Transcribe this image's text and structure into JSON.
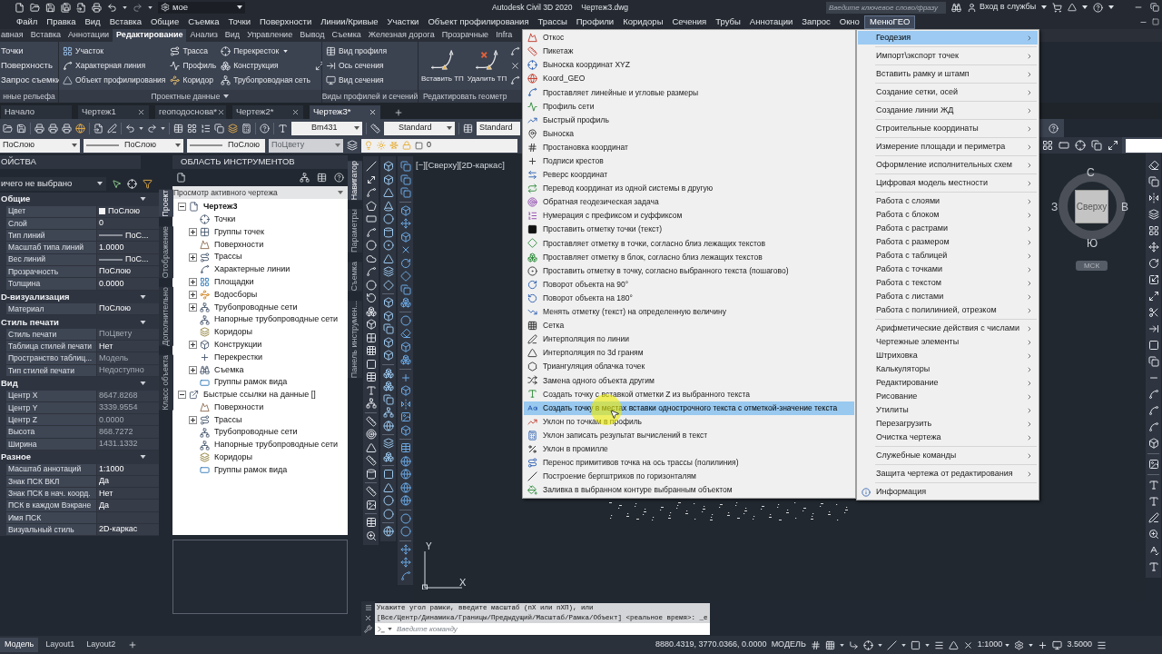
{
  "title_bar": {
    "workspace": "мое",
    "title": "Autodesk Civil 3D 2020",
    "file_name": "Чертеж3.dwg",
    "search_placeholder": "Введите ключевое слово/фразу",
    "sign_in": "Вход в службы"
  },
  "menu_bar": [
    {
      "label": "Файл",
      "selected": false
    },
    {
      "label": "Правка",
      "selected": false
    },
    {
      "label": "Вид",
      "selected": false
    },
    {
      "label": "Вставка",
      "selected": false
    },
    {
      "label": "Общие",
      "selected": false
    },
    {
      "label": "Съемка",
      "selected": false
    },
    {
      "label": "Точки",
      "selected": false
    },
    {
      "label": "Поверхности",
      "selected": false
    },
    {
      "label": "Линии/Кривые",
      "selected": false
    },
    {
      "label": "Участки",
      "selected": false
    },
    {
      "label": "Объект профилирования",
      "selected": false
    },
    {
      "label": "Трассы",
      "selected": false
    },
    {
      "label": "Профили",
      "selected": false
    },
    {
      "label": "Коридоры",
      "selected": false
    },
    {
      "label": "Сечения",
      "selected": false
    },
    {
      "label": "Трубы",
      "selected": false
    },
    {
      "label": "Аннотации",
      "selected": false
    },
    {
      "label": "Запрос",
      "selected": false
    },
    {
      "label": "Окно",
      "selected": false
    },
    {
      "label": "МенюГЕО",
      "selected": true
    }
  ],
  "ribbon_tabs": [
    {
      "label": "авная",
      "selected": false
    },
    {
      "label": "Вставка",
      "selected": false
    },
    {
      "label": "Аннотации",
      "selected": false
    },
    {
      "label": "Редактирование",
      "selected": true
    },
    {
      "label": "Анализ",
      "selected": false
    },
    {
      "label": "Вид",
      "selected": false
    },
    {
      "label": "Управление",
      "selected": false
    },
    {
      "label": "Вывод",
      "selected": false
    },
    {
      "label": "Съемка",
      "selected": false
    },
    {
      "label": "Железная дорога",
      "selected": false
    },
    {
      "label": "Прозрачные",
      "selected": false
    },
    {
      "label": "Infra",
      "selected": false
    }
  ],
  "ribbon_panels": [
    {
      "title": "нные рельефа",
      "title_menu": false,
      "columns": [
        [
          {
            "label": "Точки",
            "kind": "label"
          },
          {
            "label": "Поверхность",
            "kind": "label"
          },
          {
            "label": "Запрос съемки",
            "kind": "label"
          }
        ]
      ]
    },
    {
      "title": "Проектные данные",
      "title_menu": true,
      "columns": [
        [
          {
            "label": "Участок",
            "kind": "small",
            "menu": false
          },
          {
            "label": "Характерная линия",
            "kind": "small",
            "menu": false
          },
          {
            "label": "Объект профилирования",
            "kind": "small",
            "menu": false
          }
        ],
        [
          {
            "label": "Трасса",
            "kind": "small",
            "menu": false
          },
          {
            "label": "Профиль",
            "kind": "small",
            "menu": false
          },
          {
            "label": "Коридор",
            "kind": "small",
            "menu": false
          }
        ],
        [
          {
            "label": "Перекресток",
            "kind": "small",
            "menu": true
          },
          {
            "label": "Конструкция",
            "kind": "small",
            "menu": false
          },
          {
            "label": "Трубопроводная сеть",
            "kind": "small",
            "menu": false
          }
        ],
        [
          {
            "kind": "icon"
          }
        ]
      ]
    },
    {
      "title": "Виды профилей и сечений",
      "title_menu": false,
      "columns": [
        [
          {
            "label": "Вид профиля",
            "kind": "small",
            "menu": false
          },
          {
            "label": "Ось сечения",
            "kind": "small",
            "menu": false
          },
          {
            "label": "Вид сечения",
            "kind": "small",
            "menu": false
          }
        ]
      ]
    },
    {
      "title": "Редактировать геометр",
      "title_menu": false,
      "columns": [
        [
          {
            "label": "Вставить ТП",
            "kind": "large"
          }
        ],
        [
          {
            "label": "Удалить ТП",
            "kind": "large"
          }
        ],
        [
          {
            "kind": "icon"
          },
          {
            "kind": "icon"
          },
          {
            "kind": "icon"
          }
        ]
      ]
    }
  ],
  "document_tabs": [
    {
      "label": "Начало",
      "closable": false,
      "selected": false
    },
    {
      "label": "Чертеж1",
      "closable": true,
      "selected": false
    },
    {
      "label": "геоподоснова*",
      "closable": true,
      "selected": false
    },
    {
      "label": "Чертеж2*",
      "closable": true,
      "selected": false
    },
    {
      "label": "Чертеж3*",
      "closable": true,
      "selected": true
    }
  ],
  "styles_toolbar": {
    "text_style": "Bm431",
    "dimension_style": "Standard",
    "table_style": "Standard"
  },
  "properties_toolbar": {
    "color_setting": "ПоСлою",
    "linetype": "ПоСлою",
    "lineweight": "ПоСлою",
    "plot_style": {
      "value": "ПоЦвету",
      "disabled": true
    },
    "layer": "0"
  },
  "properties_palette": {
    "title": "ОЙСТВА",
    "selection": "ичего не выбрано",
    "sections": [
      {
        "title": "Общие",
        "expanded": true,
        "rows": [
          {
            "label": "Цвет",
            "value": "ПоСлою",
            "kind": "color",
            "readonly": false
          },
          {
            "label": "Слой",
            "value": "0",
            "kind": "text",
            "readonly": false
          },
          {
            "label": "Тип линий",
            "value": "ПоС...",
            "kind": "line",
            "readonly": false
          },
          {
            "label": "Масштаб типа линий",
            "value": "1.0000",
            "kind": "text",
            "readonly": false
          },
          {
            "label": "Вес линий",
            "value": "ПоС...",
            "kind": "line",
            "readonly": false
          },
          {
            "label": "Прозрачность",
            "value": "ПоСлою",
            "kind": "text",
            "readonly": false
          },
          {
            "label": "Толщина",
            "value": "0.0000",
            "kind": "text",
            "readonly": false
          }
        ]
      },
      {
        "title": "D-визуализация",
        "expanded": true,
        "rows": [
          {
            "label": "Материал",
            "value": "ПоСлою",
            "kind": "text",
            "readonly": false
          }
        ]
      },
      {
        "title": "Стиль печати",
        "expanded": true,
        "rows": [
          {
            "label": "Стиль печати",
            "value": "ПоЦвету",
            "kind": "text",
            "readonly": true
          },
          {
            "label": "Таблица стилей печати",
            "value": "Нет",
            "kind": "text",
            "readonly": false
          },
          {
            "label": "Пространство таблиц...",
            "value": "Модель",
            "kind": "text",
            "readonly": true
          },
          {
            "label": "Тип стилей печати",
            "value": "Недоступно",
            "kind": "text",
            "readonly": true
          }
        ]
      },
      {
        "title": "Вид",
        "expanded": true,
        "rows": [
          {
            "label": "Центр X",
            "value": "8647.8268",
            "kind": "text",
            "readonly": true
          },
          {
            "label": "Центр Y",
            "value": "3339.9554",
            "kind": "text",
            "readonly": true
          },
          {
            "label": "Центр Z",
            "value": "0.0000",
            "kind": "text",
            "readonly": true
          },
          {
            "label": "Высота",
            "value": "868.7272",
            "kind": "text",
            "readonly": true
          },
          {
            "label": "Ширина",
            "value": "1431.1332",
            "kind": "text",
            "readonly": true
          }
        ]
      },
      {
        "title": "Разное",
        "expanded": true,
        "rows": [
          {
            "label": "Масштаб аннотаций",
            "value": "1:1000",
            "kind": "text",
            "readonly": false
          },
          {
            "label": "Знак ПСК ВКЛ",
            "value": "Да",
            "kind": "text",
            "readonly": false
          },
          {
            "label": "Знак ПСК в нач. коорд.",
            "value": "Нет",
            "kind": "text",
            "readonly": false
          },
          {
            "label": "ПСК в каждом Вэкране",
            "value": "Да",
            "kind": "text",
            "readonly": false
          },
          {
            "label": "Имя ПСК",
            "kind": "text"
          },
          {
            "label": "Визуальный стиль",
            "value": "2D-каркас",
            "kind": "text",
            "readonly": false
          }
        ]
      }
    ],
    "tabs": [
      {
        "label": "Проект",
        "selected": true
      },
      {
        "label": "Отображение",
        "selected": false
      },
      {
        "label": "Дополнительно",
        "selected": false
      },
      {
        "label": "Класс объекта",
        "selected": false
      }
    ]
  },
  "tool_palette": {
    "title": "ОБЛАСТЬ ИНСТРУМЕНТОВ",
    "view": "Просмотр активного чертежа",
    "tree": [
      {
        "label": "Чертеж3",
        "active": true,
        "expanded": true,
        "children": [
          {
            "label": "Точки"
          },
          {
            "label": "Группы точек",
            "expanded": false
          },
          {
            "label": "Поверхности"
          },
          {
            "label": "Трассы",
            "expanded": false
          },
          {
            "label": "Характерные линии"
          },
          {
            "label": "Площадки",
            "expanded": false
          },
          {
            "label": "Водосборы",
            "expanded": false
          },
          {
            "label": "Трубопроводные сети",
            "expanded": false
          },
          {
            "label": "Напорные трубопроводные сети"
          },
          {
            "label": "Коридоры"
          },
          {
            "label": "Конструкции",
            "expanded": false
          },
          {
            "label": "Перекрестки"
          },
          {
            "label": "Съемка",
            "expanded": false
          },
          {
            "label": "Группы рамок вида"
          }
        ]
      },
      {
        "label": "Быстрые ссылки на данные []",
        "active": false,
        "expanded": true,
        "children": [
          {
            "label": "Поверхности"
          },
          {
            "label": "Трассы",
            "expanded": false
          },
          {
            "label": "Трубопроводные сети"
          },
          {
            "label": "Напорные трубопроводные сети"
          },
          {
            "label": "Коридоры"
          },
          {
            "label": "Группы рамок вида"
          }
        ]
      }
    ],
    "tabs": [
      {
        "label": "Навигатор",
        "selected": true
      },
      {
        "label": "Параметры",
        "selected": false
      },
      {
        "label": "Съемка",
        "selected": false
      },
      {
        "label": "Панель инструмен...",
        "selected": false
      }
    ]
  },
  "drawing": {
    "viewport_label": "[−][Сверху][2D-каркас]",
    "viewcube": {
      "face": "Сверху",
      "north": "С",
      "south": "Ю",
      "west": "З",
      "east": "В",
      "ucs_button": "МСК"
    },
    "ucs": {
      "y": "Y",
      "x": "X"
    }
  },
  "command_line": {
    "history": [
      "Укажите угол рамки, введите масштаб (nX или nXП), или",
      "[Все/Центр/Динамика/Границы/Предыдущий/Масштаб/Рамка/Объект] <реальное время>: _e"
    ],
    "placeholder": "Введите команду"
  },
  "status_bar": {
    "layout_tabs": [
      {
        "label": "Модель",
        "selected": true
      },
      {
        "label": "Layout1",
        "selected": false
      },
      {
        "label": "Layout2",
        "selected": false
      }
    ],
    "coordinates": "8880.4319, 3770.0366, 0.0000",
    "space": "МОДЕЛЬ",
    "annotation_scale": "1:1000",
    "scale_value": "3.5000"
  },
  "geodesy_submenu": {
    "items": [
      {
        "label": "Откос",
        "selected": false
      },
      {
        "label": "Пикетаж",
        "selected": false
      },
      {
        "label": "Выноска координат XYZ",
        "selected": false
      },
      {
        "label": "Koord_GEO",
        "selected": false
      },
      {
        "label": "Проставляет линейные и угловые размеры",
        "selected": false
      },
      {
        "label": "Профиль сети",
        "selected": false
      },
      {
        "label": "Быстрый профиль",
        "selected": false
      },
      {
        "label": "Выноска",
        "selected": false
      },
      {
        "label": "Простановка координат",
        "selected": false
      },
      {
        "label": "Подписи крестов",
        "selected": false
      },
      {
        "label": "Реверс координат",
        "selected": false
      },
      {
        "label": "Перевод координат из одной системы в другую",
        "selected": false
      },
      {
        "label": "Обратная геодезическая задача",
        "selected": false
      },
      {
        "label": "Нумерация с префиксом и суффиксом",
        "selected": false
      },
      {
        "label": "Проставить отметку точки (текст)",
        "selected": false
      },
      {
        "label": "Проставляет отметку в точки, согласно близ лежащих текстов",
        "selected": false
      },
      {
        "label": "Проставляет отметку в блок, согласно близ лежащих текстов",
        "selected": false
      },
      {
        "label": "Проставить отметку в точку, согласно выбранного текста (пошагово)",
        "selected": false
      },
      {
        "label": "Поворот объекта на 90°",
        "selected": false
      },
      {
        "label": "Поворот объекта на 180°",
        "selected": false
      },
      {
        "label": "Менять отметку (текст) на определенную величину",
        "selected": false
      },
      {
        "label": "Сетка",
        "selected": false
      },
      {
        "label": "Интерполяция по линии",
        "selected": false
      },
      {
        "label": "Интерполяция по 3d граням",
        "selected": false
      },
      {
        "label": "Триангуляция облачка точек",
        "selected": false
      },
      {
        "label": "Замена одного объекта другим",
        "selected": false
      },
      {
        "label": "Создать точку с вставкой отметки Z из выбранного текста",
        "selected": false
      },
      {
        "label": "Создать точку в местах вставки однострочного текста с отметкой-значение текста",
        "selected": true
      },
      {
        "label": "Уклон по точкам в профиль",
        "selected": false
      },
      {
        "label": "Уклон записать результат вычислений в текст",
        "selected": false
      },
      {
        "label": "Уклон в промилле",
        "selected": false
      },
      {
        "label": "Перенос примитивов точка на ось трассы (полилиния)",
        "selected": false
      },
      {
        "label": "Построение бергштрихов по горизонталям",
        "selected": false
      },
      {
        "label": "Заливка в выбранном контуре выбранным объектом",
        "selected": false
      }
    ]
  },
  "geo_menu": {
    "groups": [
      [
        {
          "label": "Геодезия",
          "kind": "submenu",
          "selected": true
        }
      ],
      [
        {
          "label": "Импорт\\экспорт точек",
          "kind": "submenu",
          "selected": false
        }
      ],
      [
        {
          "label": "Вставить рамку и штамп",
          "kind": "submenu",
          "selected": false
        }
      ],
      [
        {
          "label": "Создание сетки, осей",
          "kind": "submenu",
          "selected": false
        }
      ],
      [
        {
          "label": "Создание линии ЖД",
          "kind": "submenu",
          "selected": false
        }
      ],
      [
        {
          "label": "Строительные координаты",
          "kind": "submenu",
          "selected": false
        }
      ],
      [
        {
          "label": "Измерение площади и периметра",
          "kind": "submenu",
          "selected": false
        }
      ],
      [
        {
          "label": "Оформление исполнительных схем",
          "kind": "submenu",
          "selected": false
        }
      ],
      [
        {
          "label": "Цифровая модель местности",
          "kind": "submenu",
          "selected": false
        }
      ],
      [
        {
          "label": "Работа с слоями",
          "kind": "submenu",
          "selected": false
        },
        {
          "label": "Работа с блоком",
          "kind": "submenu",
          "selected": false
        },
        {
          "label": "Работа с растрами",
          "kind": "submenu",
          "selected": false
        },
        {
          "label": "Работа с размером",
          "kind": "submenu",
          "selected": false
        },
        {
          "label": "Работа с таблицей",
          "kind": "submenu",
          "selected": false
        },
        {
          "label": "Работа с точками",
          "kind": "submenu",
          "selected": false
        },
        {
          "label": "Работа с текстом",
          "kind": "submenu",
          "selected": false
        },
        {
          "label": "Работа с листами",
          "kind": "submenu",
          "selected": false
        },
        {
          "label": "Работа с полилинией, отрезком",
          "kind": "submenu",
          "selected": false
        }
      ],
      [
        {
          "label": "Арифметические действия с числами",
          "kind": "submenu",
          "selected": false
        },
        {
          "label": "Чертежные элементы",
          "kind": "submenu",
          "selected": false
        },
        {
          "label": "Штриховка",
          "kind": "submenu",
          "selected": false
        },
        {
          "label": "Калькуляторы",
          "kind": "submenu",
          "selected": false
        },
        {
          "label": "Редактирование",
          "kind": "submenu",
          "selected": false
        },
        {
          "label": "Рисование",
          "kind": "submenu",
          "selected": false
        },
        {
          "label": "Утилиты",
          "kind": "submenu",
          "selected": false
        },
        {
          "label": "Перезагрузить",
          "kind": "submenu",
          "selected": false
        },
        {
          "label": "Очистка чертежа",
          "kind": "submenu",
          "selected": false
        }
      ],
      [
        {
          "label": "Служебные команды",
          "kind": "submenu",
          "selected": false
        }
      ],
      [
        {
          "label": "Защита чертежа от редактирования",
          "kind": "submenu",
          "selected": false
        }
      ],
      [
        {
          "label": "Информация",
          "kind": "command",
          "selected": false
        }
      ]
    ]
  }
}
